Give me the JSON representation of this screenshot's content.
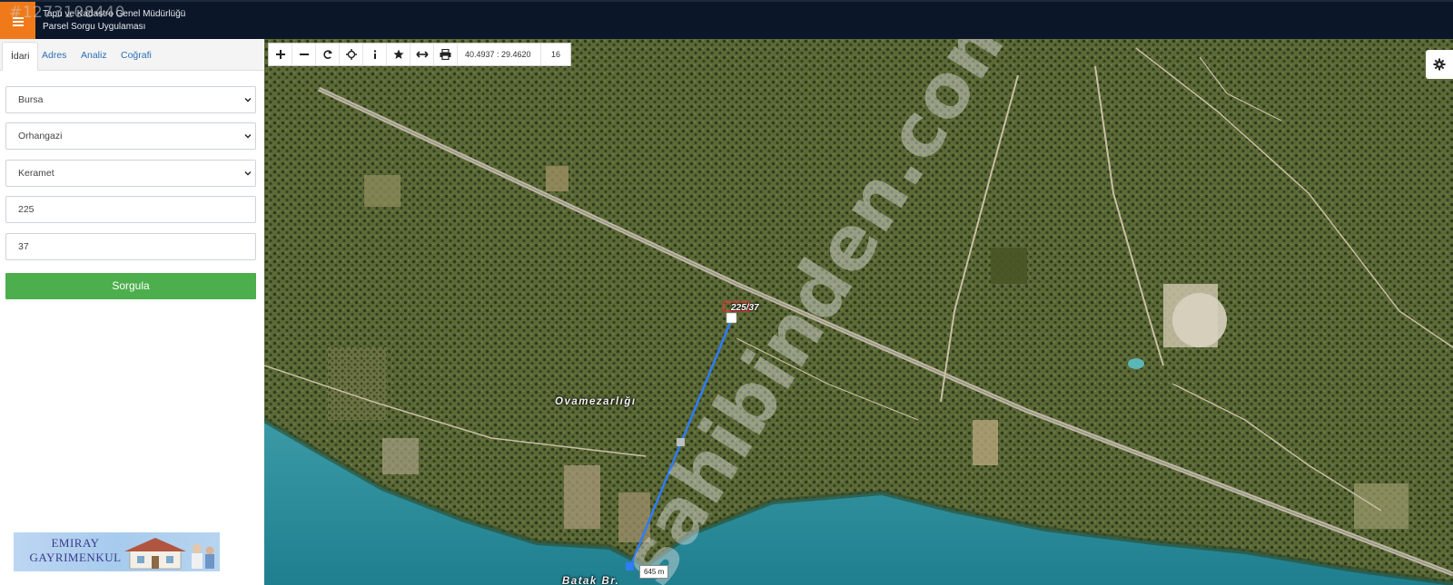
{
  "header": {
    "line1": "Tapu ve Kadastro Genel Müdürlüğü",
    "line2": "Parsel Sorgu Uygulaması",
    "listing_id": "#1273108440"
  },
  "sidebar": {
    "tabs": [
      "İdari",
      "Adres",
      "Analiz",
      "Coğrafi"
    ],
    "active_tab": "İdari",
    "province": "Bursa",
    "district": "Orhangazi",
    "neighborhood": "Keramet",
    "block_no": "225",
    "parcel_no": "37",
    "query_label": "Sorgula",
    "ad_text_line1": "EMIRAY",
    "ad_text_line2": "GAYRIMENKUL"
  },
  "map": {
    "coordinates": "40.4937 : 29.4620",
    "zoom_level": "16",
    "parcel_label": "225/37",
    "place_label_1": "Ovamezarlığı",
    "place_label_2": "Batak Br.",
    "measure_label": "645 m",
    "watermark": "sahibinden.com"
  },
  "colors": {
    "header_bg": "#0b1628",
    "menu_accent": "#f07a1a",
    "query_button": "#4cae4c",
    "measure_line": "#2e7cf6",
    "sea": "#2f8f9d"
  },
  "icons": [
    "menu-icon",
    "zoom-in-icon",
    "zoom-out-icon",
    "refresh-icon",
    "locate-icon",
    "info-icon",
    "star-icon",
    "measure-icon",
    "print-icon",
    "gear-icon"
  ]
}
